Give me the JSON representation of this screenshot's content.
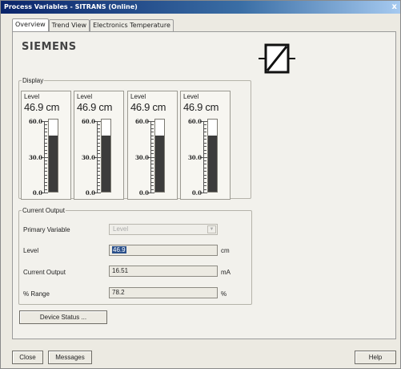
{
  "window": {
    "title": "Process Variables - SITRANS  (Online)",
    "close_glyph": "x"
  },
  "tabs": [
    {
      "label": "Overview",
      "active": true
    },
    {
      "label": "Trend View",
      "active": false
    },
    {
      "label": "Electronics Temperature",
      "active": false
    }
  ],
  "brand": {
    "logo_text": "SIEMENS"
  },
  "device_icon": "level-transmitter-icon",
  "display": {
    "legend": "Display",
    "gauges": [
      {
        "label": "Level",
        "value": "46.9 cm",
        "level_fraction": 0.782,
        "ticks": [
          "60.0",
          "30.0",
          "0.0"
        ]
      },
      {
        "label": "Level",
        "value": "46.9 cm",
        "level_fraction": 0.782,
        "ticks": [
          "60.0",
          "30.0",
          "0.0"
        ]
      },
      {
        "label": "Level",
        "value": "46.9 cm",
        "level_fraction": 0.782,
        "ticks": [
          "60.0",
          "30.0",
          "0.0"
        ]
      },
      {
        "label": "Level",
        "value": "46.9 cm",
        "level_fraction": 0.782,
        "ticks": [
          "60.0",
          "30.0",
          "0.0"
        ]
      }
    ]
  },
  "current_output": {
    "legend": "Current Output",
    "primary_variable": {
      "label": "Primary Variable",
      "value": "Level"
    },
    "level": {
      "label": "Level",
      "value": "46.9",
      "unit": "cm"
    },
    "current": {
      "label": "Current Output",
      "value": "16.51",
      "unit": "mA"
    },
    "range": {
      "label": "% Range",
      "value": "78.2",
      "unit": "%"
    }
  },
  "buttons": {
    "device_status": "Device Status ...",
    "close": "Close",
    "messages": "Messages",
    "help": "Help"
  },
  "colors": {
    "bar_fill": "#3c3c3c",
    "title_bar": "#0a246a"
  }
}
